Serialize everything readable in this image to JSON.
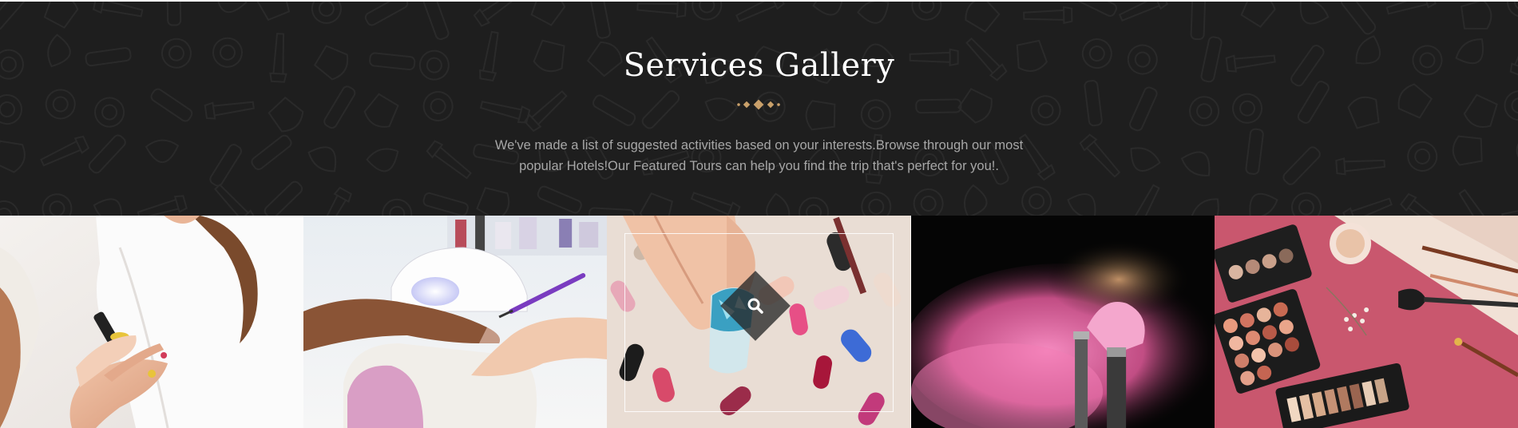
{
  "section": {
    "title": "Services Gallery",
    "description_line1": "We've made a list of suggested activities based on your interests.Browse through our most",
    "description_line2": "popular Hotels!Our Featured Tours can help you find the trip that's perfect for you!."
  },
  "colors": {
    "background": "#1e1e1e",
    "accent": "#c9a06a",
    "title": "#ffffff",
    "text": "#a7a7a7"
  },
  "gallery": {
    "items": [
      {
        "icon": "manicure-polish-photo"
      },
      {
        "icon": "uv-lamp-manicure-photo"
      },
      {
        "icon": "nail-art-tips-photo",
        "hover_icon": "search-icon"
      },
      {
        "icon": "pink-powder-brush-photo"
      },
      {
        "icon": "eyeshadow-palette-photo"
      }
    ]
  }
}
